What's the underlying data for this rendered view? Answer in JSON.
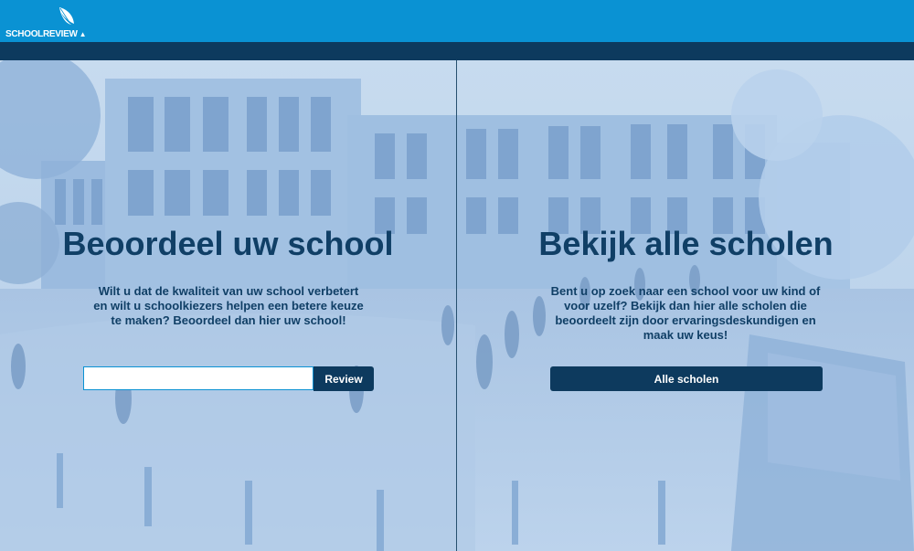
{
  "header": {
    "logo_text": "SCHOOLREVIEW",
    "logo_icon": "feather-icon"
  },
  "left_panel": {
    "title": "Beoordeel uw school",
    "description": "Wilt u dat de kwaliteit van uw school verbetert en wilt u schoolkiezers helpen een betere keuze te maken? Beoordeel dan hier uw school!",
    "search_value": "",
    "search_placeholder": "",
    "button_label": "Review"
  },
  "right_panel": {
    "title": "Bekijk alle scholen",
    "description": "Bent u op zoek naar een school voor uw kind of voor uzelf? Bekijk dan hier alle scholen die beoordeelt zijn door ervaringsdeskundigen en maak uw keus!",
    "button_label": "Alle scholen"
  },
  "colors": {
    "topbar": "#0a92d3",
    "navy": "#0d3a5e",
    "text": "#103f66"
  }
}
